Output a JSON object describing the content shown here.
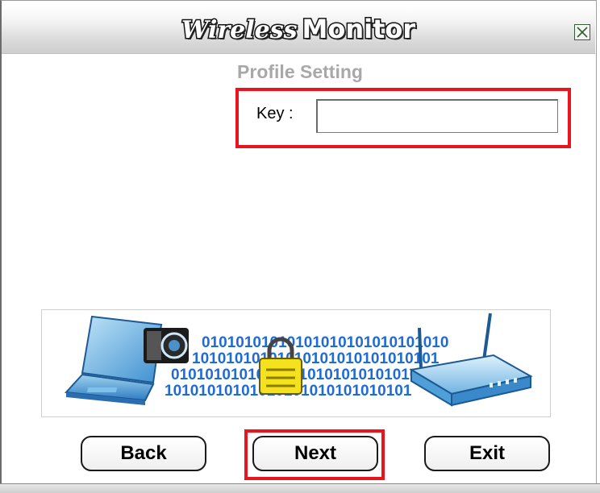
{
  "window": {
    "title_part1": "Wireless",
    "title_part2": "Monitor",
    "close_label": "Close"
  },
  "subtitle": "Profile Setting",
  "form": {
    "key_label": "Key :",
    "key_value": "",
    "key_placeholder": ""
  },
  "banner": {
    "binary_rows": [
      "01010101010101010101010101010",
      "10101010101010101010101010101",
      "01010101010101010101010101010",
      "10101010101010101010101010101"
    ]
  },
  "buttons": {
    "back": "Back",
    "next": "Next",
    "exit": "Exit"
  },
  "colors": {
    "highlight": "#e8141e",
    "binary_blue": "#1e6bd6",
    "subtitle_gray": "#a8a8a8"
  }
}
